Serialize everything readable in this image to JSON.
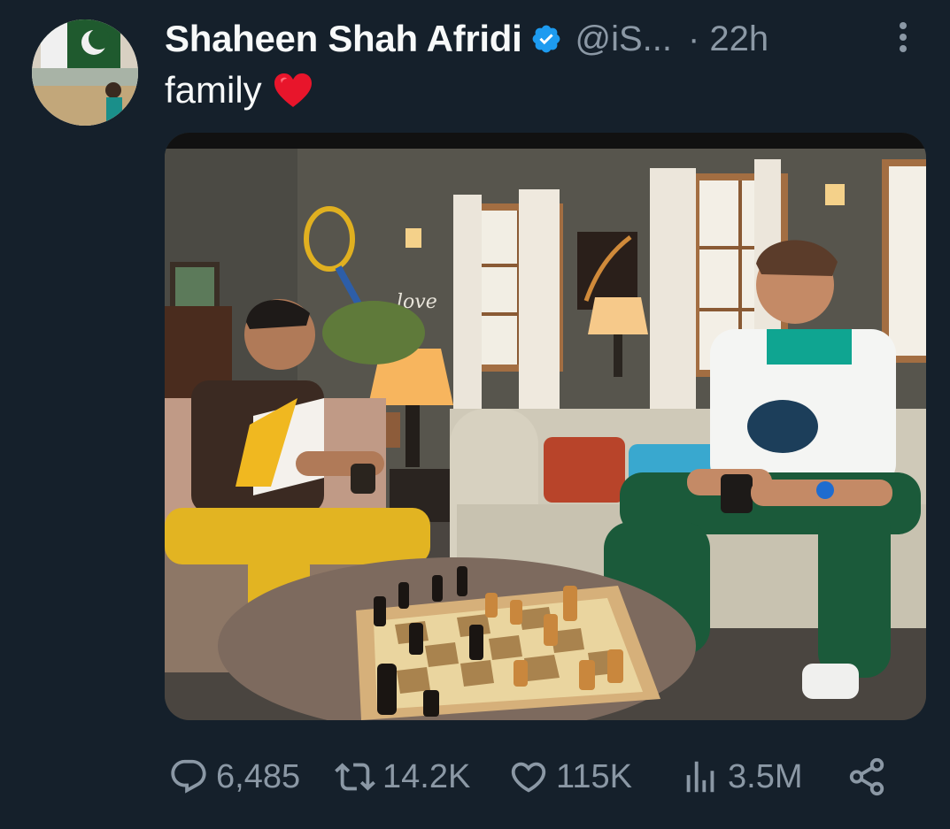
{
  "tweet": {
    "author": {
      "display_name": "Shaheen Shah Afridi",
      "handle": "@iS...",
      "verified": true
    },
    "time": "· 22h",
    "text": "family",
    "emoji": "heart-emoji"
  },
  "actions": {
    "replies": "6,485",
    "retweets": "14.2K",
    "likes": "115K",
    "views": "3.5M"
  },
  "icons": {
    "reply": "reply-icon",
    "retweet": "retweet-icon",
    "like": "heart-icon",
    "views": "views-icon",
    "share": "share-icon",
    "more": "more-icon",
    "verified": "verified-badge-icon"
  },
  "colors": {
    "background": "#15202b",
    "primary_text": "#f7f9f9",
    "secondary_text": "#8b98a5",
    "verified_blue": "#1d9bf0",
    "heart_red": "#e8152b"
  }
}
